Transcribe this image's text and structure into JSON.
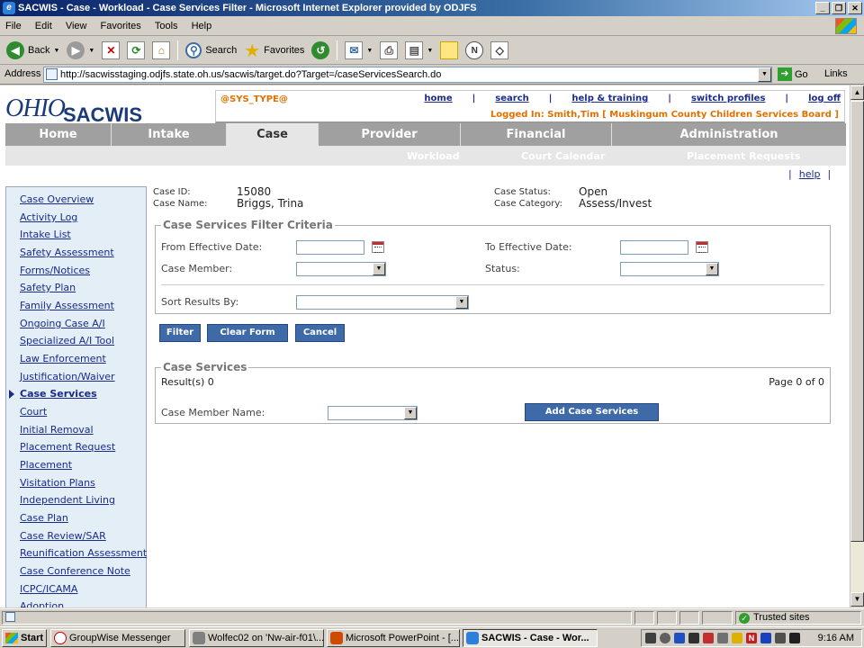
{
  "window": {
    "title": "SACWIS - Case - Workload - Case Services Filter - Microsoft Internet Explorer provided by ODJFS"
  },
  "menu": [
    "File",
    "Edit",
    "View",
    "Favorites",
    "Tools",
    "Help"
  ],
  "toolbar": {
    "back": "Back",
    "search": "Search",
    "favorites": "Favorites"
  },
  "address": {
    "label": "Address",
    "url": "http://sacwisstaging.odjfs.state.oh.us/sacwis/target.do?Target=/caseServicesSearch.do",
    "go": "Go",
    "links": "Links"
  },
  "header": {
    "logo_ohio": "OHIO",
    "logo_sacwis": "SACWIS",
    "sys_type": "@SYS_TYPE@",
    "links": {
      "home": "home",
      "search": "search",
      "help_training": "help & training",
      "switch_profiles": "switch profiles",
      "log_off": "log off"
    },
    "logged_in": "Logged In:  Smith,Tim [ Muskingum County Children Services Board ]"
  },
  "nav": {
    "tabs": [
      "Home",
      "Intake",
      "Case",
      "Provider",
      "Financial",
      "Administration"
    ],
    "active": "Case",
    "subtabs": [
      "Workload",
      "Court Calendar",
      "Placement Requests"
    ]
  },
  "help_link": "help",
  "sidebar": {
    "items": [
      "Case Overview",
      "Activity Log",
      "Intake List",
      "Safety Assessment",
      "Forms/Notices",
      "Safety Plan",
      "Family Assessment",
      "Ongoing Case A/I",
      "Specialized A/I Tool",
      "Law Enforcement",
      "Justification/Waiver",
      "Case Services",
      "Court",
      "Initial Removal",
      "Placement Request",
      "Placement",
      "Visitation Plans",
      "Independent Living",
      "Case Plan",
      "Case Review/SAR",
      "Reunification Assessment",
      "Case Conference Note",
      "ICPC/ICAMA",
      "Adoption"
    ],
    "active_item": "Case Services"
  },
  "case_info": {
    "case_id_label": "Case ID:",
    "case_id": "15080",
    "case_name_label": "Case Name:",
    "case_name": "Briggs, Trina",
    "status_label": "Case Status:",
    "status": "Open",
    "category_label": "Case Category:",
    "category": "Assess/Invest"
  },
  "filter": {
    "legend": "Case Services Filter Criteria",
    "from_date_label": "From Effective Date:",
    "from_date_value": "",
    "to_date_label": "To Effective Date:",
    "to_date_value": "",
    "member_label": "Case Member:",
    "member_value": "",
    "status_label": "Status:",
    "status_value": "",
    "sort_label": "Sort Results By:",
    "sort_value": ""
  },
  "buttons": {
    "filter": "Filter",
    "clear": "Clear Form",
    "cancel": "Cancel",
    "add": "Add Case Services"
  },
  "results": {
    "legend": "Case Services",
    "count": "Result(s) 0",
    "page": "Page 0 of 0",
    "member_name_label": "Case Member Name:",
    "member_name_value": ""
  },
  "statusbar": {
    "zone": "Trusted sites"
  },
  "taskbar": {
    "start": "Start",
    "tasks": [
      "GroupWise Messenger",
      "Wolfec02 on 'Nw-air-f01\\...",
      "Microsoft PowerPoint - [...",
      "SACWIS - Case - Wor..."
    ],
    "clock": "9:16 AM"
  }
}
